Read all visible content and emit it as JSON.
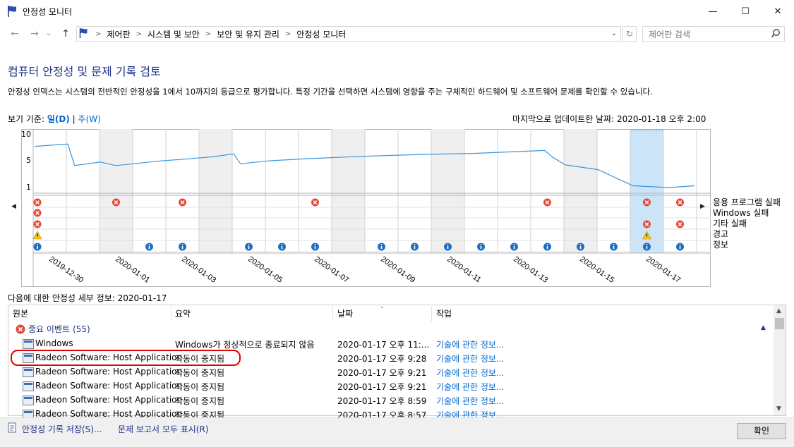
{
  "window": {
    "title": "안정성 모니터",
    "minimize": "—",
    "maximize": "☐",
    "close": "✕"
  },
  "nav": {
    "back": "←",
    "forward": "→",
    "recent": "⌄",
    "up": "↑",
    "breadcrumbs": [
      "제어판",
      "시스템 및 보안",
      "보안 및 유지 관리",
      "안정성 모니터"
    ],
    "separator": ">",
    "dropdown": "⌄",
    "refresh": "↻",
    "search_placeholder": "제어판 검색"
  },
  "page": {
    "heading": "컴퓨터 안정성 및 문제 기록 검토",
    "description": "안정성 인덱스는 시스템의 전반적인 안정성을 1에서 10까지의 등급으로 평가합니다. 특정 기간을 선택하면 시스템에 영향을 주는 구체적인 하드웨어 및 소프트웨어 문제를 확인할 수 있습니다.",
    "view_by_label": "보기 기준:",
    "view_day": "일(D)",
    "view_sep": "|",
    "view_week": "주(W)",
    "last_updated": "마지막으로 업데이트한 날짜: 2020-01-18 오후 2:00"
  },
  "chart_data": {
    "type": "line",
    "y_ticks": [
      "10",
      "5",
      "1"
    ],
    "ylim": [
      1,
      10
    ],
    "x_labels": [
      "2019-12-30",
      "2020-01-01",
      "2020-01-03",
      "2020-01-05",
      "2020-01-07",
      "2020-01-09",
      "2020-01-11",
      "2020-01-13",
      "2020-01-15",
      "2020-01-17"
    ],
    "selected_date": "2020-01-17",
    "series": [
      {
        "values_by_day": [
          8.1,
          8.5,
          4.8,
          5.4,
          4.8,
          5.6,
          5.9,
          6.3,
          6.8,
          5.1,
          5.6,
          6.0,
          6.4,
          6.7,
          6.9,
          7.2,
          7.4,
          6.2,
          4.9,
          4.1,
          1.3,
          1.0,
          1.3
        ]
      }
    ],
    "event_rows": [
      "응용 프로그램 실패",
      "Windows 실패",
      "기타 실패",
      "경고",
      "정보"
    ],
    "events": {
      "app_failure": [
        0,
        2,
        4,
        8,
        15,
        18,
        19
      ],
      "windows_failure": [
        0
      ],
      "other_failure": [
        0,
        18,
        19
      ],
      "warning": [
        0,
        18
      ],
      "info": [
        0,
        3,
        4,
        6,
        7,
        8,
        10,
        11,
        12,
        13,
        14,
        15,
        16,
        17,
        18,
        19
      ]
    },
    "colors": {
      "line": "#3a96dd",
      "selected": "#cce4f7",
      "weekend": "#efefef",
      "error": "#e04a3a",
      "warning": "#f5c518",
      "info": "#1f6fc1"
    }
  },
  "details": {
    "title": "다음에 대한 안정성 세부 정보: 2020-01-17",
    "columns": [
      "원본",
      "요약",
      "날짜",
      "작업"
    ],
    "group": {
      "label": "중요 이벤트",
      "count": "(55)"
    },
    "rows": [
      {
        "source": "Windows",
        "summary": "Windows가 정상적으로 종료되지 않음",
        "date": "2020-01-17 오후 11:...",
        "action": "기술에 관한 정보..."
      },
      {
        "source": "Radeon Software: Host Application",
        "summary": "작동이 중지됨",
        "date": "2020-01-17 오후 9:28",
        "action": "기술에 관한 정보..."
      },
      {
        "source": "Radeon Software: Host Application",
        "summary": "작동이 중지됨",
        "date": "2020-01-17 오후 9:21",
        "action": "기술에 관한 정보..."
      },
      {
        "source": "Radeon Software: Host Application",
        "summary": "작동이 중지됨",
        "date": "2020-01-17 오후 9:21",
        "action": "기술에 관한 정보..."
      },
      {
        "source": "Radeon Software: Host Application",
        "summary": "작동이 중지됨",
        "date": "2020-01-17 오후 8:59",
        "action": "기술에 관한 정보..."
      },
      {
        "source": "Radeon Software: Host Application",
        "summary": "작동이 중지됨",
        "date": "2020-01-17 오후 8:57",
        "action": "기술에 관한 정보..."
      }
    ]
  },
  "footer": {
    "save_history": "안정성 기록 저장(S)...",
    "view_all_reports": "문제 보고서 모두 표시(R)",
    "ok": "확인"
  }
}
